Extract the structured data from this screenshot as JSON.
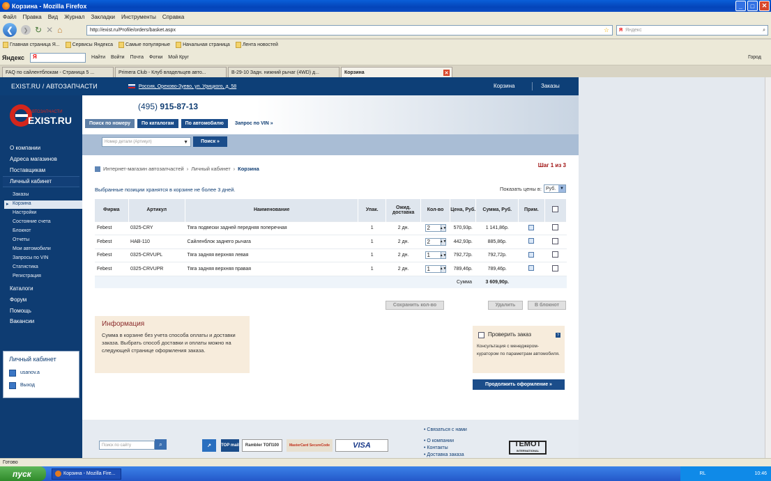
{
  "window": {
    "title": "Корзина - Mozilla Firefox"
  },
  "menu": [
    "Файл",
    "Правка",
    "Вид",
    "Журнал",
    "Закладки",
    "Инструменты",
    "Справка"
  ],
  "address": {
    "url": "http://exist.ru/Profile/orders/basket.aspx"
  },
  "search": {
    "placeholder": "Яндекс",
    "prefix": "Я"
  },
  "bookmarks": [
    "Главная страница Я...",
    "Сервисы Яндекса",
    "Самые популярные",
    "Начальная страница",
    "Лента новостей"
  ],
  "yandexbar": {
    "logo": "Яндекс",
    "input": "Я",
    "find": "Найти",
    "login": "Войти",
    "mail": "Почта",
    "photo": "Фотки",
    "mycircle": "Мой Круг",
    "city": "Город"
  },
  "tabs": [
    "FAQ по сайлентблокам - Страница 5 ...",
    "Primera Club - Клуб владельцев авто...",
    "B-29-10 Задн. нижний рычаг (4WD) д...",
    "Корзина"
  ],
  "site": {
    "brand": "EXIST.RU / АВТОЗАПЧАСТИ",
    "location": "Россия, Орехово-Зуево, ул. Урицкого, д. 58",
    "cart_link": "Корзина",
    "orders_link": "Заказы",
    "phone_code": "(495)",
    "phone_num": "915-87-13",
    "logo_small": "АВТОЗАПЧАСТИ",
    "logo": "EXIST.RU"
  },
  "search_tabs": [
    "Поиск по номеру",
    "По каталогам",
    "По автомобилю",
    "Запрос по VIN »"
  ],
  "part_search": {
    "placeholder": "Номер детали (Артикул)",
    "button": "Поиск »"
  },
  "sidebar": {
    "main": [
      "О компании",
      "Адреса магазинов",
      "Поставщикам",
      "Личный кабинет"
    ],
    "sub": [
      "Заказы",
      "Корзина",
      "Настройки",
      "Состояние счета",
      "Блокнот",
      "Отчеты",
      "Мои автомобили",
      "Запросы по VIN",
      "Статистика",
      "Регистрация"
    ],
    "main2": [
      "Каталоги",
      "Форум",
      "Помощь",
      "Вакансии"
    ],
    "lk_title": "Личный кабинет",
    "user": "usanov.a",
    "logout": "Выход"
  },
  "breadcrumb": {
    "a": "Интернет-магазин автозапчастей",
    "b": "Личный кабинет",
    "c": "Корзина",
    "step": "Шаг 1 из 3"
  },
  "notice": "Выбранные позиции хранятся в корзине не более 3 дней.",
  "showprice": {
    "label": "Показать цены в:",
    "value": "Руб."
  },
  "table": {
    "headers": [
      "Фирма",
      "Артикул",
      "Наименование",
      "Упак.",
      "Ожид. доставка",
      "Кол-во",
      "Цена, Руб.",
      "Сумма, Руб.",
      "Прим."
    ],
    "rows": [
      {
        "firm": "Febest",
        "art": "0325-CRY",
        "name": "Тяга подвески задней передняя поперечная",
        "pack": "1",
        "del": "2 дн.",
        "qty": "2",
        "price": "570,93р.",
        "sum": "1 141,86р."
      },
      {
        "firm": "Febest",
        "art": "HAB-110",
        "name": "Сайленблок заднего рычага",
        "pack": "1",
        "del": "2 дн.",
        "qty": "2",
        "price": "442,93р.",
        "sum": "885,86р."
      },
      {
        "firm": "Febest",
        "art": "0325-CRVUPL",
        "name": "Тяга задняя верхняя левая",
        "pack": "1",
        "del": "2 дн.",
        "qty": "1",
        "price": "792,72р.",
        "sum": "792,72р."
      },
      {
        "firm": "Febest",
        "art": "0325-CRVUPR",
        "name": "Тяга задняя верхняя правая",
        "pack": "1",
        "del": "2 дн.",
        "qty": "1",
        "price": "789,46р.",
        "sum": "789,46р."
      }
    ],
    "sum_label": "Сумма",
    "sum_value": "3 609,90р."
  },
  "buttons": {
    "save_qty": "Сохранить кол-во",
    "delete": "Удалить",
    "notebook": "В блокнот",
    "continue": "Продолжить оформление »"
  },
  "info": {
    "title": "Информация",
    "text": "Сумма в корзине без учета способа оплаты и доставки заказа. Выбрать способ доставки и оплаты можно на следующей странице оформления заказа."
  },
  "check": {
    "label": "Проверить заказ",
    "desc": "Консультация с менеджером-куратором по параметрам автомобиля."
  },
  "footer": {
    "search_placeholder": "Поиск по сайту",
    "links": [
      "• Связаться с нами",
      "• О компании",
      "• Контакты",
      "• Доставка заказа"
    ],
    "temot": "TEMOT",
    "temot_sub": "INTERNATIONAL",
    "visa": "VISA",
    "mastercard": "MasterCard SecureCode",
    "rambler": "Rambler ТОП100",
    "topmail": "TOP mail"
  },
  "status": "Готово",
  "taskbar": {
    "start": "пуск",
    "task": "Корзина - Mozilla Fire...",
    "lang": "RL",
    "time": "10:46"
  }
}
